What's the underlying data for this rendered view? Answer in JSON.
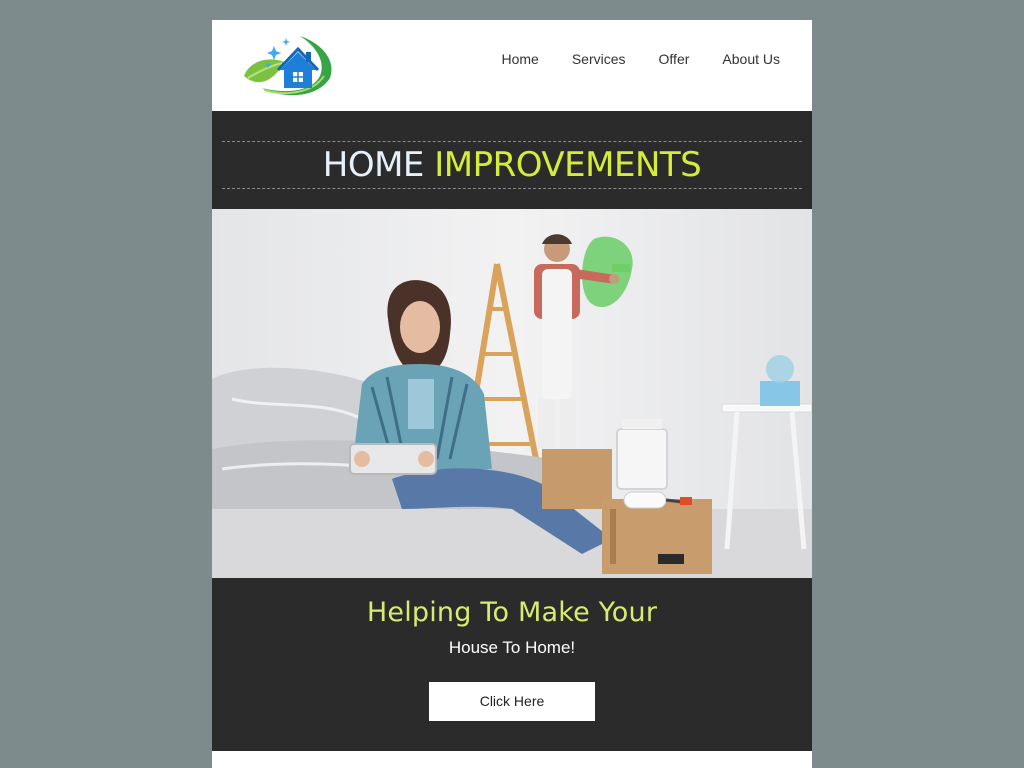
{
  "header": {
    "logo_icon": "house-leaf-logo-icon",
    "nav": [
      {
        "label": "Home"
      },
      {
        "label": "Services"
      },
      {
        "label": "Offer"
      },
      {
        "label": "About Us"
      }
    ]
  },
  "title": {
    "word1": "HOME",
    "word2": "IMPROVEMENTS"
  },
  "hero": {
    "image_icon": "home-renovation-photo"
  },
  "cta": {
    "heading": "Helping To Make Your",
    "subheading": "House To Home!",
    "button_label": "Click Here"
  },
  "colors": {
    "page_background": "#7e8b8c",
    "dark_band": "#2b2b2b",
    "accent_green": "#d6ec3b",
    "heading_green": "#d9ea72"
  }
}
